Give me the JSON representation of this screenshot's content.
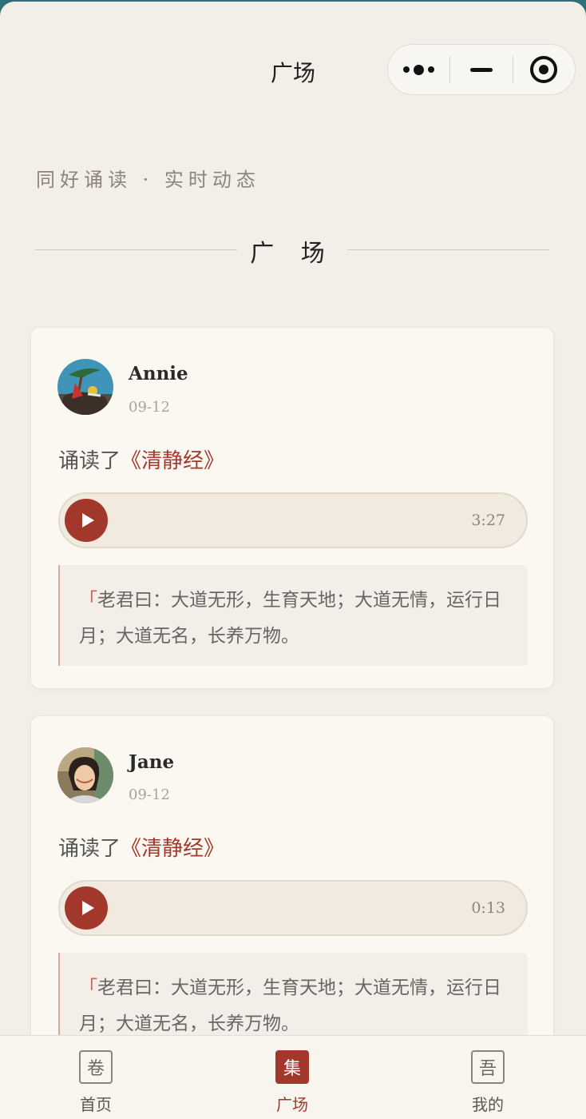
{
  "nav": {
    "title": "广场"
  },
  "header": {
    "subtitle": "同好诵读 · 实时动态",
    "section_title": "广 场"
  },
  "posts": [
    {
      "user": "Annie",
      "date": "09-12",
      "action": "诵读了",
      "book": "《清静经》",
      "duration": "3:27",
      "quote_mark": "「",
      "quote": "老君曰：大道无形，生育天地；大道无情，运行日月；大道无名，长养万物。"
    },
    {
      "user": "Jane",
      "date": "09-12",
      "action": "诵读了",
      "book": "《清静经》",
      "duration": "0:13",
      "quote_mark": "「",
      "quote": "老君曰：大道无形，生育天地；大道无情，运行日月；大道无名，长养万物。"
    }
  ],
  "tabbar": [
    {
      "icon_char": "卷",
      "label": "首页"
    },
    {
      "icon_char": "集",
      "label": "广场"
    },
    {
      "icon_char": "吾",
      "label": "我的"
    }
  ],
  "colors": {
    "accent": "#a2382c",
    "background": "#f3efe8"
  }
}
